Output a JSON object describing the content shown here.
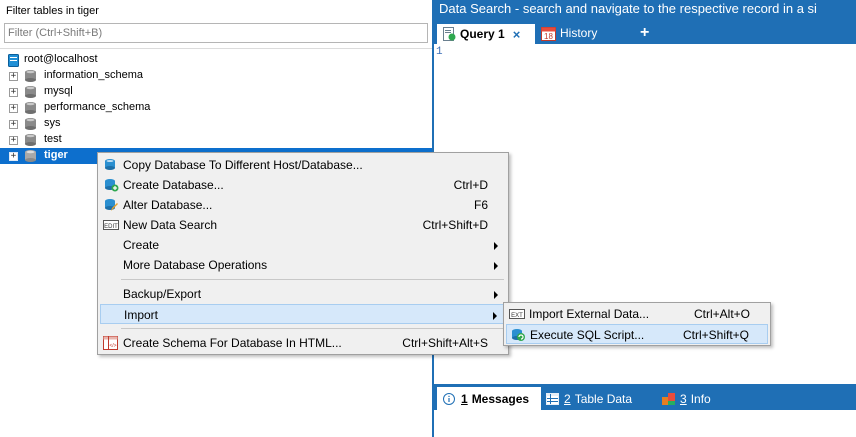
{
  "left": {
    "filter_label": "Filter tables in tiger",
    "filter_placeholder": "Filter (Ctrl+Shift+B)",
    "root": "root@localhost",
    "databases": [
      "information_schema",
      "mysql",
      "performance_schema",
      "sys",
      "test",
      "tiger"
    ],
    "selected": "tiger"
  },
  "right": {
    "header_title": "Data Search - search and navigate to the respective record in a si",
    "tabs": {
      "query": "Query 1",
      "close": "×",
      "history": "History",
      "history_icon_number": "18",
      "add": "+"
    },
    "line_number": "1",
    "bottom_tabs": {
      "messages_num": "1",
      "messages": "Messages",
      "table_num": "2",
      "table": "Table Data",
      "info_num": "3",
      "info": "Info"
    }
  },
  "context_menu": {
    "items": [
      {
        "label": "Copy Database To Different Host/Database...",
        "shortcut": "",
        "icon": "copy-db-icon"
      },
      {
        "label": "Create Database...",
        "shortcut": "Ctrl+D",
        "icon": "create-db-icon"
      },
      {
        "label": "Alter Database...",
        "shortcut": "F6",
        "icon": "alter-db-icon"
      },
      {
        "label": "New Data Search",
        "shortcut": "Ctrl+Shift+D",
        "icon": "data-search-icon"
      },
      {
        "label": "Create",
        "shortcut": "",
        "icon": ""
      },
      {
        "label": "More Database Operations",
        "shortcut": "",
        "icon": ""
      },
      {
        "label": "Backup/Export",
        "shortcut": "",
        "icon": ""
      },
      {
        "label": "Import",
        "shortcut": "",
        "icon": ""
      },
      {
        "label": "Create Schema For Database In HTML...",
        "shortcut": "Ctrl+Shift+Alt+S",
        "icon": "html-schema-icon"
      }
    ],
    "highlighted": "Import"
  },
  "submenu": {
    "items": [
      {
        "label": "Import External Data...",
        "shortcut": "Ctrl+Alt+O",
        "icon": "import-external-icon"
      },
      {
        "label": "Execute SQL Script...",
        "shortcut": "Ctrl+Shift+Q",
        "icon": "execute-sql-icon"
      }
    ],
    "highlighted": "Execute SQL Script..."
  },
  "colors": {
    "accent": "#1f6fb5",
    "selection": "#0d6fcd",
    "menu_bg": "#f0f0f0",
    "menu_highlight": "#d6e8fa"
  }
}
